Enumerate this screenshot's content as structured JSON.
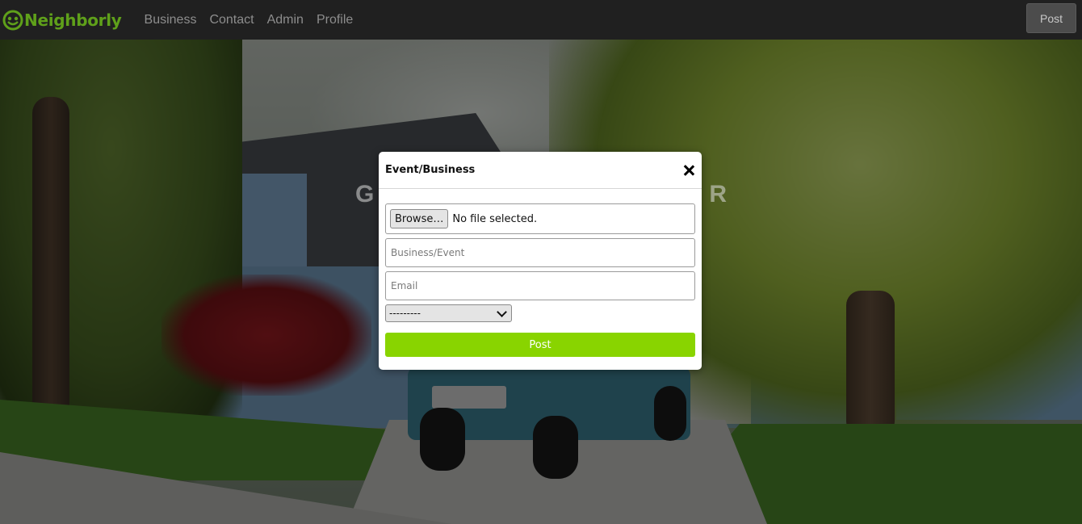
{
  "navbar": {
    "brand": "Neighborly",
    "links": [
      "Business",
      "Contact",
      "Admin",
      "Profile"
    ],
    "post_label": "Post"
  },
  "hero": {
    "left_fragment": "G",
    "right_fragment": "R"
  },
  "modal": {
    "title": "Event/Business",
    "browse_label": "Browse…",
    "file_status": "No file selected.",
    "business_placeholder": "Business/Event",
    "email_placeholder": "Email",
    "select_value": "---------",
    "submit_label": "Post"
  },
  "colors": {
    "brand_green": "#5fa01a",
    "submit_green": "#89d400",
    "navbar_bg": "#202020"
  },
  "icons": {
    "brand": "neighborly-logo-icon",
    "close": "close-icon",
    "select": "chevron-down-icon"
  }
}
